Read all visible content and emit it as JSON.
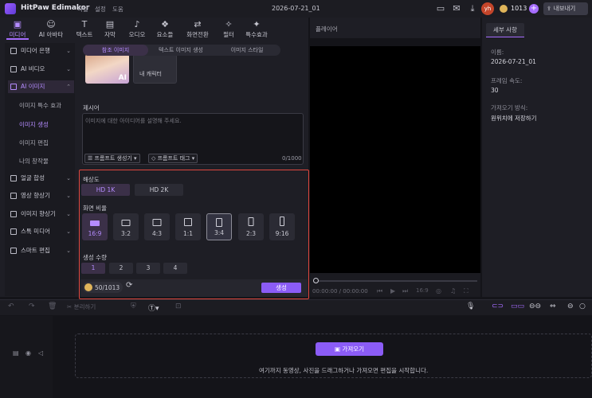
{
  "app": {
    "name": "HitPaw Edimakor",
    "menus": [
      "파일",
      "설정",
      "도움"
    ],
    "doc_title": "2026-07-21_01"
  },
  "topbar": {
    "avatar": "yh",
    "credits": "1013",
    "plus": "+",
    "export_label": "내보내기"
  },
  "tool_tabs": [
    "미디어",
    "AI 아바타",
    "텍스트",
    "자막",
    "오디오",
    "요소들",
    "화면전환",
    "필터",
    "특수효과"
  ],
  "sidebar": {
    "items": [
      "미디어 은행",
      "AI 비디오",
      "AI 이미지",
      "얼굴 합성",
      "영상 향상기",
      "이미지 향상기",
      "스톡 미디어",
      "스마트 편집"
    ],
    "subitems": [
      "이미지 특수 효과",
      "이미지 생성",
      "이미지 편집",
      "나의 창작물"
    ]
  },
  "mode_tabs": [
    "참조 이미지",
    "텍스트 이미지 생성",
    "이미지 스타일"
  ],
  "character_label": "내 캐릭터",
  "prompt": {
    "label": "제시어",
    "placeholder": "이미지에 대한 아이디어를 설명해 주세요.",
    "generator_label": "프롬프트 생성기",
    "tag_label": "프롬프트 태그",
    "count": "0/1000"
  },
  "resolution": {
    "label": "해상도",
    "options": [
      "HD 1K",
      "HD 2K"
    ]
  },
  "aspect": {
    "label": "화면 비율",
    "options": [
      "16:9",
      "3:2",
      "4:3",
      "1:1",
      "3:4",
      "2:3",
      "9:16"
    ]
  },
  "quantity": {
    "label": "생성 수량",
    "options": [
      "1",
      "2",
      "3",
      "4"
    ]
  },
  "generate": {
    "credits": "50/1013",
    "button": "생성"
  },
  "player": {
    "label": "플레이어",
    "time": "00:00:00 / 00:00:00",
    "ratio": "16:9"
  },
  "details": {
    "tab": "세부 사항",
    "name_label": "이름:",
    "name_value": "2026-07-21_01",
    "fps_label": "프레임 속도:",
    "fps_value": "30",
    "import_label": "가져오기 방식:",
    "import_value": "원위치에 저장하기"
  },
  "timeline": {
    "split_label": "분리하기",
    "import_button": "가져오기",
    "hint": "여기까지 동영상, 사진을 드래그하거나 가져오면 편집을 시작합니다."
  },
  "colors": {
    "accent": "#8b5cf6",
    "highlight_border": "#e0473e"
  }
}
